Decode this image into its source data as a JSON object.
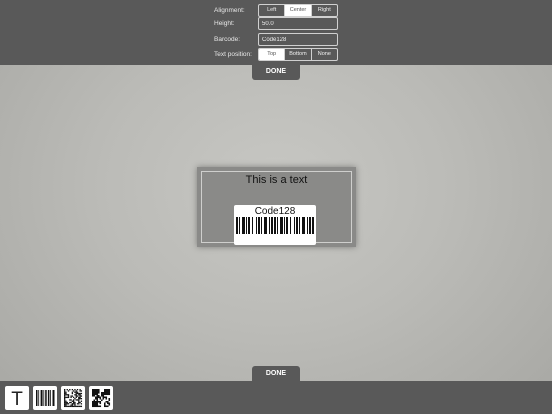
{
  "settings": {
    "alignment": {
      "label": "Alignment:",
      "options": [
        "Left",
        "Center",
        "Right"
      ],
      "selected": "Center"
    },
    "height": {
      "label": "Height:",
      "value": "50.0"
    },
    "barcode": {
      "label": "Barcode:",
      "value": "Code128"
    },
    "text_position": {
      "label": "Text position:",
      "options": [
        "Top",
        "Bottom",
        "None"
      ],
      "selected": "Top"
    }
  },
  "done_top": "DONE",
  "done_bottom": "DONE",
  "canvas": {
    "text_item": "This is a text",
    "barcode_caption": "Code128"
  },
  "toolbar": {
    "text_tool_glyph": "T",
    "tools": [
      "text-tool-icon",
      "barcode-tool-icon",
      "datamatrix-tool-icon",
      "qrcode-tool-icon"
    ]
  },
  "colors": {
    "panel": "#595959",
    "background": "#bbbbb7",
    "canvas": "#8a8a88",
    "selected_segment": "#ffffff"
  }
}
